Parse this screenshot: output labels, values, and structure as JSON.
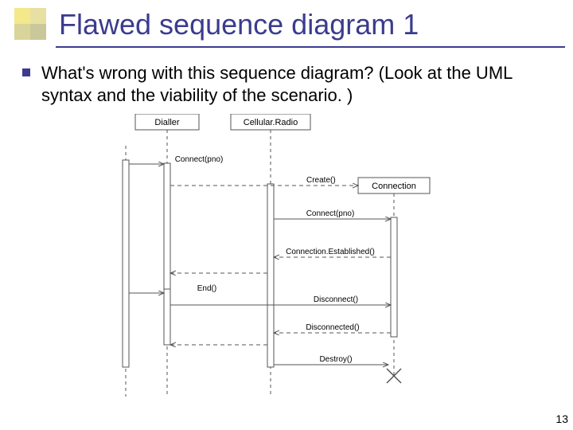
{
  "title": "Flawed sequence diagram 1",
  "bullet": "What's wrong with this sequence diagram? (Look at the UML syntax and the viability of the scenario. )",
  "page_number": "13",
  "diagram": {
    "lifelines": {
      "dialler": "Dialler",
      "cellular_radio": "Cellular.Radio",
      "connection": "Connection"
    },
    "messages": {
      "connect1": "Connect(pno)",
      "create": "Create()",
      "connect2": "Connect(pno)",
      "conn_est": "Connection.Established()",
      "end": "End()",
      "disconnect": "Disconnect()",
      "disconnected": "Disconnected()",
      "destroy": "Destroy()"
    }
  }
}
